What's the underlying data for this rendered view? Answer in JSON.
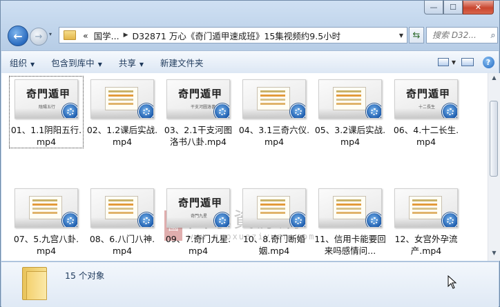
{
  "window": {
    "caption": {
      "minimize": "—",
      "maximize": "☐",
      "close": "✕"
    }
  },
  "nav": {
    "back_glyph": "←",
    "forward_glyph": "→",
    "history_glyph": "▾",
    "path_overflow": "«",
    "breadcrumb": [
      "国学...",
      "D32871 万心《奇门遁甲速成班》15集视频约9.5小时"
    ],
    "refresh_glyph": "⇆",
    "search_placeholder": "搜索 D32..."
  },
  "toolbar": {
    "organize": "组织",
    "include_in_library": "包含到库中",
    "share": "共享",
    "new_folder": "新建文件夹",
    "help_glyph": "?"
  },
  "files": [
    {
      "label": "01、1.1阴阳五行.mp4",
      "thumb": "title",
      "art": "奇門遁甲",
      "sub": "陰陽五行",
      "selected": true
    },
    {
      "label": "02、1.2课后实战.mp4",
      "thumb": "slide"
    },
    {
      "label": "03、2.1干支河图洛书八卦.mp4",
      "thumb": "title",
      "art": "奇門遁甲",
      "sub": "干支河圖洛書八卦"
    },
    {
      "label": "04、3.1三奇六仪.mp4",
      "thumb": "slide"
    },
    {
      "label": "05、3.2课后实战.mp4",
      "thumb": "slide"
    },
    {
      "label": "06、4.十二长生.mp4",
      "thumb": "title",
      "art": "奇門遁甲",
      "sub": "十二長生"
    },
    {
      "label": "07、5.九宫八卦.mp4",
      "thumb": "slide"
    },
    {
      "label": "08、6.八门八神.mp4",
      "thumb": "slide"
    },
    {
      "label": "09、7.奇门九星.mp4",
      "thumb": "title",
      "art": "奇門遁甲",
      "sub": "奇門九星"
    },
    {
      "label": "10、8.奇门断婚姻.mp4",
      "thumb": "slide"
    },
    {
      "label": "11、信用卡能要回来吗感情问...",
      "thumb": "slide"
    },
    {
      "label": "12、女宫外孕流产.mp4",
      "thumb": "slide"
    }
  ],
  "watermark": {
    "seal": "國",
    "text": "國學資源網",
    "url": "www.guoxueziyuan.com"
  },
  "details": {
    "count": "15 个对象"
  }
}
